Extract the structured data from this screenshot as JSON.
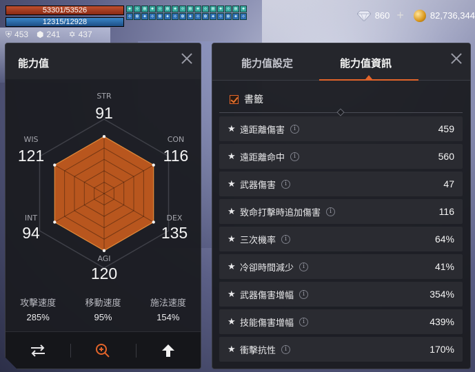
{
  "hud": {
    "hp": "53301/53526",
    "mp": "12315/12928",
    "defense": "453",
    "resist": "241",
    "rank": "437",
    "buffs": [
      "✦",
      "✧",
      "❄",
      "✦",
      "✧",
      "❄",
      "✦",
      "✧",
      "❄",
      "✦",
      "✧",
      "❄",
      "✦",
      "✧",
      "❄",
      "✦",
      "✧",
      "❄",
      "✦",
      "✧",
      "❄",
      "✦",
      "✧",
      "❄",
      "✦",
      "✧",
      "❄",
      "✦",
      "✧",
      "❄",
      "✦",
      "✧"
    ]
  },
  "currency": {
    "diamond": "860",
    "gold": "82,736,344"
  },
  "stats_panel": {
    "title": "能力值",
    "stats": [
      {
        "key": "str",
        "label": "STR",
        "value": "91"
      },
      {
        "key": "con",
        "label": "CON",
        "value": "116"
      },
      {
        "key": "dex",
        "label": "DEX",
        "value": "135"
      },
      {
        "key": "agi",
        "label": "AGI",
        "value": "120"
      },
      {
        "key": "int",
        "label": "INT",
        "value": "94"
      },
      {
        "key": "wis",
        "label": "WIS",
        "value": "121"
      }
    ],
    "speeds": [
      {
        "name": "攻擊速度",
        "value": "285%"
      },
      {
        "name": "移動速度",
        "value": "95%"
      },
      {
        "name": "施法速度",
        "value": "154%"
      }
    ]
  },
  "info_panel": {
    "tabs": [
      "能力值設定",
      "能力值資訊"
    ],
    "active_tab": 1,
    "bookmark_label": "書籤",
    "rows": [
      {
        "label": "遠距離傷害",
        "value": "459"
      },
      {
        "label": "遠距離命中",
        "value": "560"
      },
      {
        "label": "武器傷害",
        "value": "47"
      },
      {
        "label": "致命打擊時追加傷害",
        "value": "116"
      },
      {
        "label": "三次機率",
        "value": "64%"
      },
      {
        "label": "冷卻時間減少",
        "value": "41%"
      },
      {
        "label": "武器傷害增幅",
        "value": "354%"
      },
      {
        "label": "技能傷害增幅",
        "value": "439%"
      },
      {
        "label": "衝擊抗性",
        "value": "170%"
      }
    ]
  },
  "colors": {
    "accent": "#e2642a",
    "radar_fill": "#b8561e",
    "hp_bar": "#a8401f",
    "mp_bar": "#2a6aa8"
  }
}
